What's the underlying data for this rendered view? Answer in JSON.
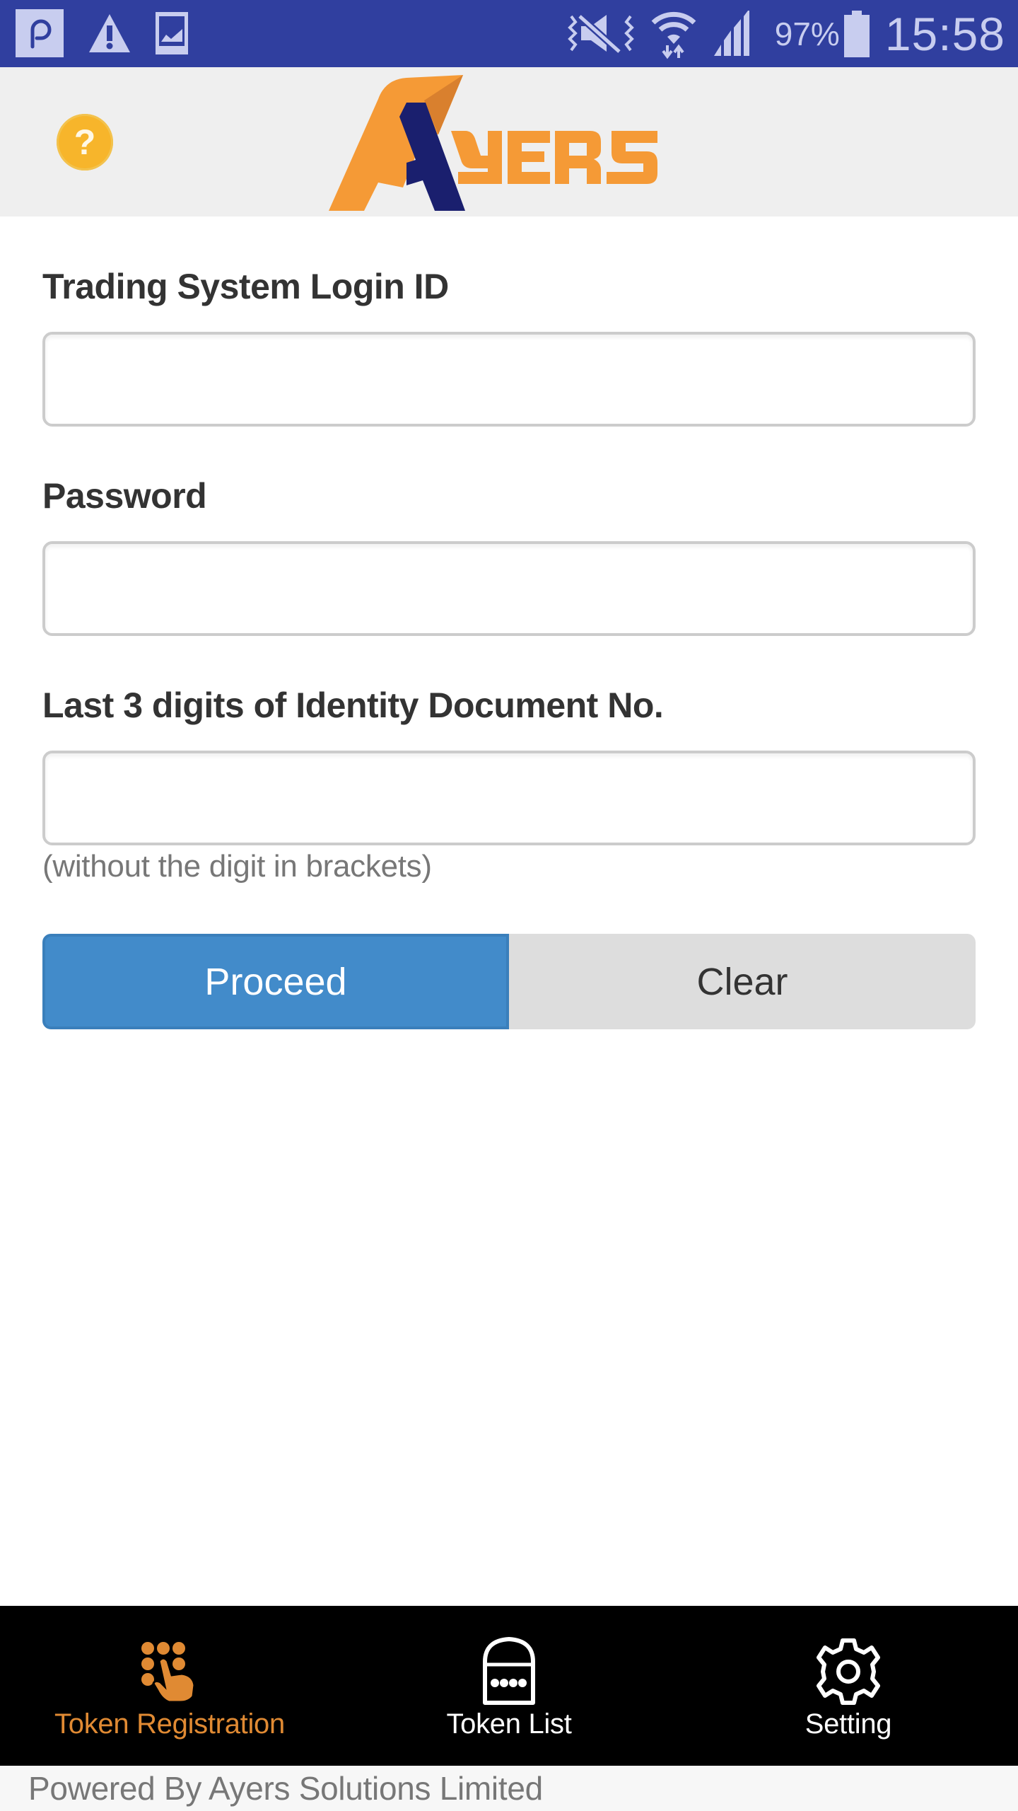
{
  "status_bar": {
    "left_icons": [
      "app-notification-icon",
      "warning-icon",
      "image-icon"
    ],
    "right_icons": [
      "vibrate-mute-icon",
      "wifi-data-icon",
      "cell-signal-icon",
      "battery-icon"
    ],
    "battery_percent": "97%",
    "time": "15:58"
  },
  "header": {
    "help_icon": "question-mark-icon",
    "help_glyph": "?",
    "logo_text": "YERS",
    "logo_initial": "A",
    "colors": {
      "orange": "#f59a36",
      "navy": "#1a1f6e",
      "help": "#f7b52b"
    }
  },
  "form": {
    "login_id": {
      "label": "Trading System Login ID",
      "value": "",
      "placeholder": ""
    },
    "password": {
      "label": "Password",
      "value": "",
      "placeholder": ""
    },
    "id_digits": {
      "label": "Last 3 digits of Identity Document No.",
      "value": "",
      "placeholder": "",
      "hint": "(without the digit in brackets)"
    },
    "proceed_label": "Proceed",
    "clear_label": "Clear",
    "colors": {
      "proceed": "#428bca",
      "clear": "#dddddd"
    }
  },
  "bottom_nav": {
    "items": [
      {
        "label": "Token Registration",
        "icon": "keypad-touch-icon",
        "active": true
      },
      {
        "label": "Token List",
        "icon": "token-lock-icon",
        "active": false
      },
      {
        "label": "Setting",
        "icon": "gear-icon",
        "active": false
      }
    ],
    "active_color": "#e08a33"
  },
  "footer": {
    "text": "Powered By Ayers Solutions Limited"
  }
}
